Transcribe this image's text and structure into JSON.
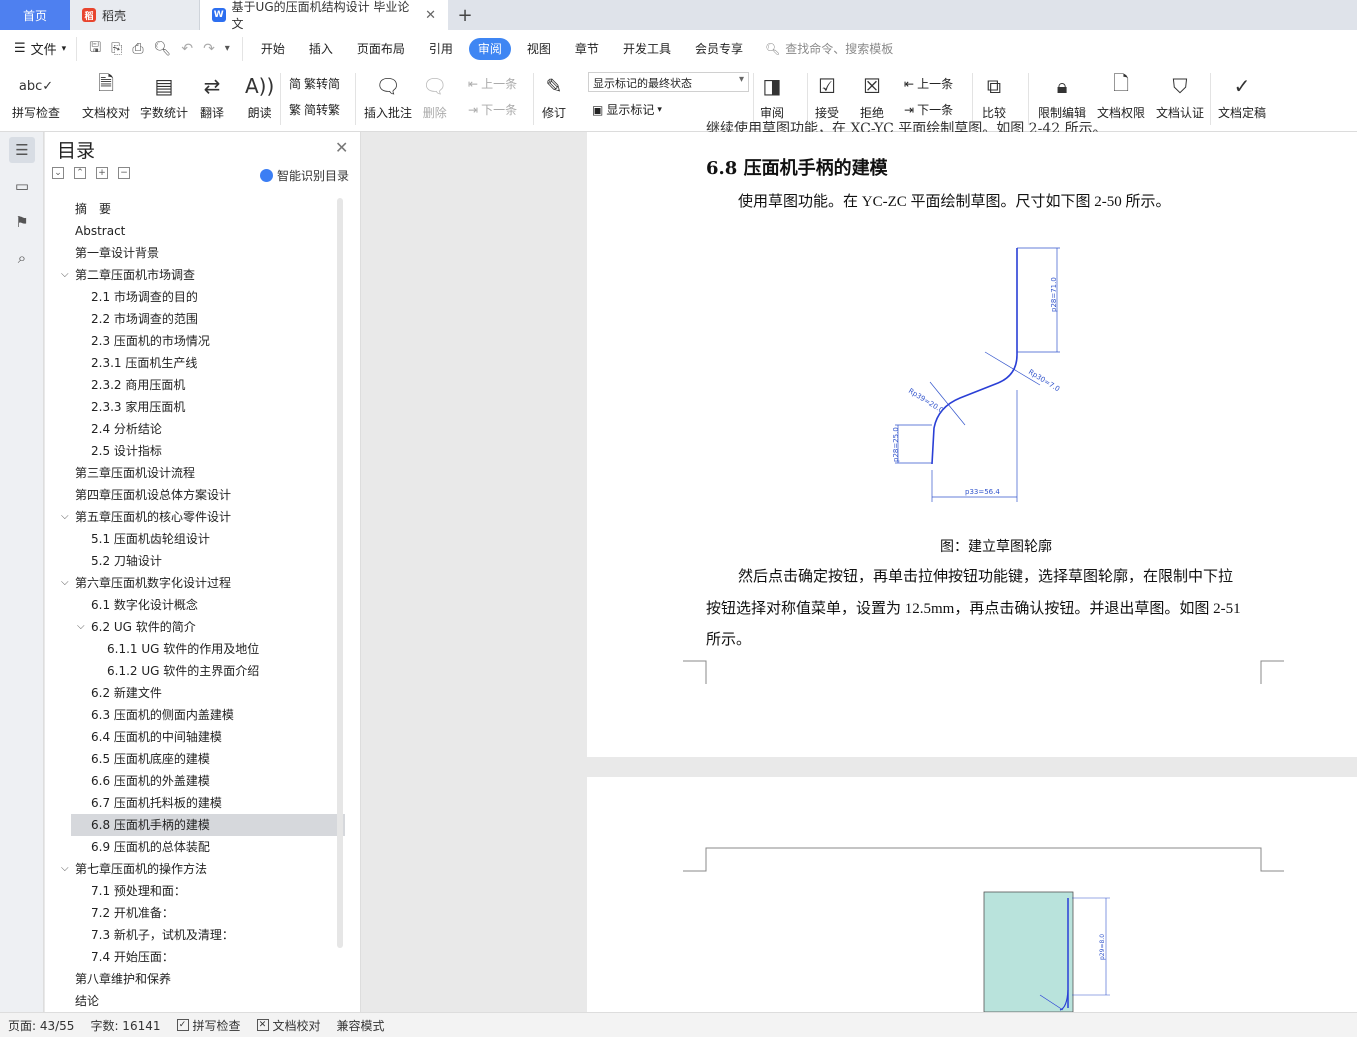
{
  "tabs": {
    "home": "首页",
    "daoke": "稻壳",
    "doc": "基于UG的压面机结构设计 毕业论文",
    "new_tab_symbol": "+"
  },
  "menubar": {
    "file": "文件",
    "items": [
      "开始",
      "插入",
      "页面布局",
      "引用",
      "审阅",
      "视图",
      "章节",
      "开发工具",
      "会员专享"
    ],
    "active": "审阅",
    "search_placeholder": "查找命令、搜索模板"
  },
  "ribbon": {
    "spell_check": "拼写检查",
    "doc_proof": "文档校对",
    "word_count": "字数统计",
    "translate": "翻译",
    "read_aloud": "朗读",
    "trad_to_simp": "繁转简",
    "simp_to_trad": "简转繁",
    "insert_comment": "插入批注",
    "delete": "删除",
    "prev": "上一条",
    "next": "下一条",
    "revise": "修订",
    "display_mode": "显示标记的最终状态",
    "show_marks": "显示标记",
    "review": "审阅",
    "accept": "接受",
    "reject": "拒绝",
    "prev2": "上一条",
    "next2": "下一条",
    "compare": "比较",
    "restrict_edit": "限制编辑",
    "doc_permission": "文档权限",
    "doc_cert": "文档认证",
    "doc_finalize": "文档定稿"
  },
  "toc": {
    "title": "目录",
    "smart": "智能识别目录",
    "items": [
      {
        "label": "摘　要",
        "level": 1,
        "arrow": ""
      },
      {
        "label": "Abstract",
        "level": 1,
        "arrow": ""
      },
      {
        "label": "第一章设计背景",
        "level": 1,
        "arrow": ""
      },
      {
        "label": "第二章压面机市场调查",
        "level": 1,
        "arrow": "v"
      },
      {
        "label": "2.1 市场调查的目的",
        "level": 2,
        "arrow": ""
      },
      {
        "label": "2.2 市场调查的范围",
        "level": 2,
        "arrow": ""
      },
      {
        "label": "2.3 压面机的市场情况",
        "level": 2,
        "arrow": ""
      },
      {
        "label": "2.3.1 压面机生产线",
        "level": 2,
        "arrow": ""
      },
      {
        "label": "2.3.2 商用压面机",
        "level": 2,
        "arrow": ""
      },
      {
        "label": "2.3.3 家用压面机",
        "level": 2,
        "arrow": ""
      },
      {
        "label": "2.4 分析结论",
        "level": 2,
        "arrow": ""
      },
      {
        "label": "2.5 设计指标",
        "level": 2,
        "arrow": ""
      },
      {
        "label": "第三章压面机设计流程",
        "level": 1,
        "arrow": ""
      },
      {
        "label": "第四章压面机设总体方案设计",
        "level": 1,
        "arrow": ""
      },
      {
        "label": "第五章压面机的核心零件设计",
        "level": 1,
        "arrow": "v"
      },
      {
        "label": "5.1 压面机齿轮组设计",
        "level": 2,
        "arrow": ""
      },
      {
        "label": "5.2 刀轴设计",
        "level": 2,
        "arrow": ""
      },
      {
        "label": "第六章压面机数字化设计过程",
        "level": 1,
        "arrow": "v"
      },
      {
        "label": "6.1 数字化设计概念",
        "level": 2,
        "arrow": ""
      },
      {
        "label": "6.2 UG 软件的简介",
        "level": 2,
        "arrow": "v"
      },
      {
        "label": "6.1.1 UG 软件的作用及地位",
        "level": 3,
        "arrow": ""
      },
      {
        "label": "6.1.2 UG 软件的主界面介绍",
        "level": 3,
        "arrow": ""
      },
      {
        "label": "6.2  新建文件",
        "level": 2,
        "arrow": ""
      },
      {
        "label": "6.3  压面机的侧面内盖建模",
        "level": 2,
        "arrow": ""
      },
      {
        "label": "6.4 压面机的中间轴建模",
        "level": 2,
        "arrow": ""
      },
      {
        "label": "6.5  压面机底座的建模",
        "level": 2,
        "arrow": ""
      },
      {
        "label": "6.6  压面机的外盖建模",
        "level": 2,
        "arrow": ""
      },
      {
        "label": "6.7  压面机托料板的建模",
        "level": 2,
        "arrow": ""
      },
      {
        "label": "6.8 压面机手柄的建模",
        "level": 2,
        "arrow": "",
        "selected": true
      },
      {
        "label": "6.9 压面机的总体装配",
        "level": 2,
        "arrow": ""
      },
      {
        "label": "第七章压面机的操作方法",
        "level": 1,
        "arrow": "v"
      },
      {
        "label": "7.1 预处理和面：",
        "level": 2,
        "arrow": ""
      },
      {
        "label": "7.2 开机准备：",
        "level": 2,
        "arrow": ""
      },
      {
        "label": "7.3 新机子，试机及清理：",
        "level": 2,
        "arrow": ""
      },
      {
        "label": "7.4 开始压面：",
        "level": 2,
        "arrow": ""
      },
      {
        "label": "第八章维护和保养",
        "level": 1,
        "arrow": ""
      },
      {
        "label": "结论",
        "level": 1,
        "arrow": ""
      }
    ]
  },
  "document": {
    "cut_line": "继续使用草图功能，在 XC-YC 平面绘制草图。如图 2-42 所示。",
    "heading": "6.8 压面机手柄的建模",
    "para1": "使用草图功能。在 YC-ZC 平面绘制草图。尺寸如下图 2-50 所示。",
    "caption": "图：建立草图轮廓",
    "para2_l1": "然后点击确定按钮，再单击拉伸按钮功能键，选择草图轮廓，在限制中下拉",
    "para2_l2": "按钮选择对称值菜单，设置为 12.5mm，再点击确认按钮。并退出草图。如图 2-51",
    "para2_l3": "所示。",
    "dims": {
      "top": "p28=71.0",
      "arc_right": "Rp30=7.0",
      "arc_left": "Rp39=20.0",
      "left_vert": "p28=25.0",
      "bottom": "p33=56.4",
      "page2_dim": "p29=8.0"
    }
  },
  "statusbar": {
    "page": "页面: 43/55",
    "words": "字数: 16141",
    "spell": "拼写检查",
    "proof": "文档校对",
    "mode": "兼容模式"
  }
}
